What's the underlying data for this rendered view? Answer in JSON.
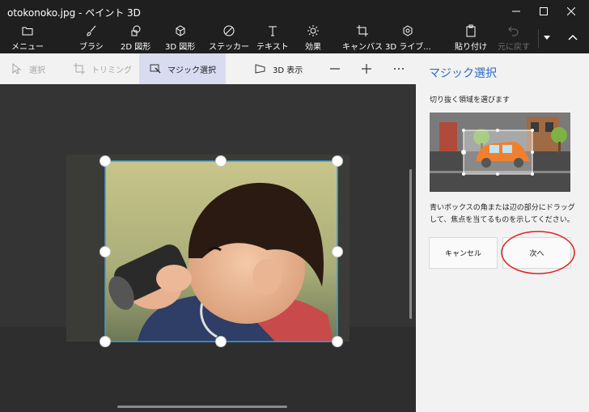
{
  "window": {
    "title": "otokonoko.jpg - ペイント 3D"
  },
  "toolbar": {
    "menu": "メニュー",
    "brush": "ブラシ",
    "shapes2d": "2D 図形",
    "shapes3d": "3D 図形",
    "stickers": "ステッカー",
    "text": "テキスト",
    "effects": "効果",
    "canvas": "キャンバス",
    "library3d": "3D ライブ...",
    "paste": "貼り付け",
    "undo": "元に戻す"
  },
  "subtoolbar": {
    "select": "選択",
    "crop": "トリミング",
    "magic_select": "マジック選択",
    "view3d": "3D 表示"
  },
  "panel": {
    "title": "マジック選択",
    "subtitle": "切り抜く領域を選びます",
    "description": "青いボックスの角または辺の部分にドラッグして、焦点を当てるものを示してください。",
    "cancel": "キャンセル",
    "next": "次へ"
  },
  "colors": {
    "accent": "#2a6cc4",
    "highlight_circle": "#e02020",
    "active_tab": "#d9dcf0",
    "selection_border": "#3aa0d8"
  }
}
